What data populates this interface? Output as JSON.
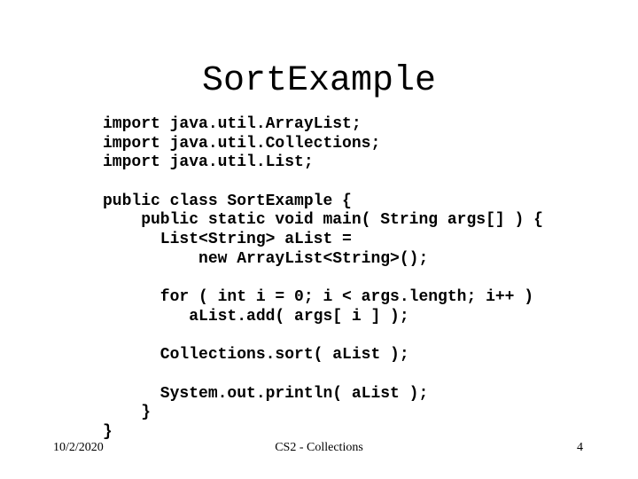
{
  "slide": {
    "title": "SortExample",
    "code_lines": [
      "import java.util.ArrayList;",
      "import java.util.Collections;",
      "import java.util.List;",
      "",
      "public class SortExample {",
      "    public static void main( String args[] ) {",
      "      List<String> aList =",
      "          new ArrayList<String>();",
      "",
      "      for ( int i = 0; i < args.length; i++ )",
      "         aList.add( args[ i ] );",
      "",
      "      Collections.sort( aList );",
      "",
      "      System.out.println( aList );",
      "    }",
      "}"
    ],
    "footer": {
      "date": "10/2/2020",
      "center": "CS2 - Collections",
      "page_number": "4"
    }
  }
}
